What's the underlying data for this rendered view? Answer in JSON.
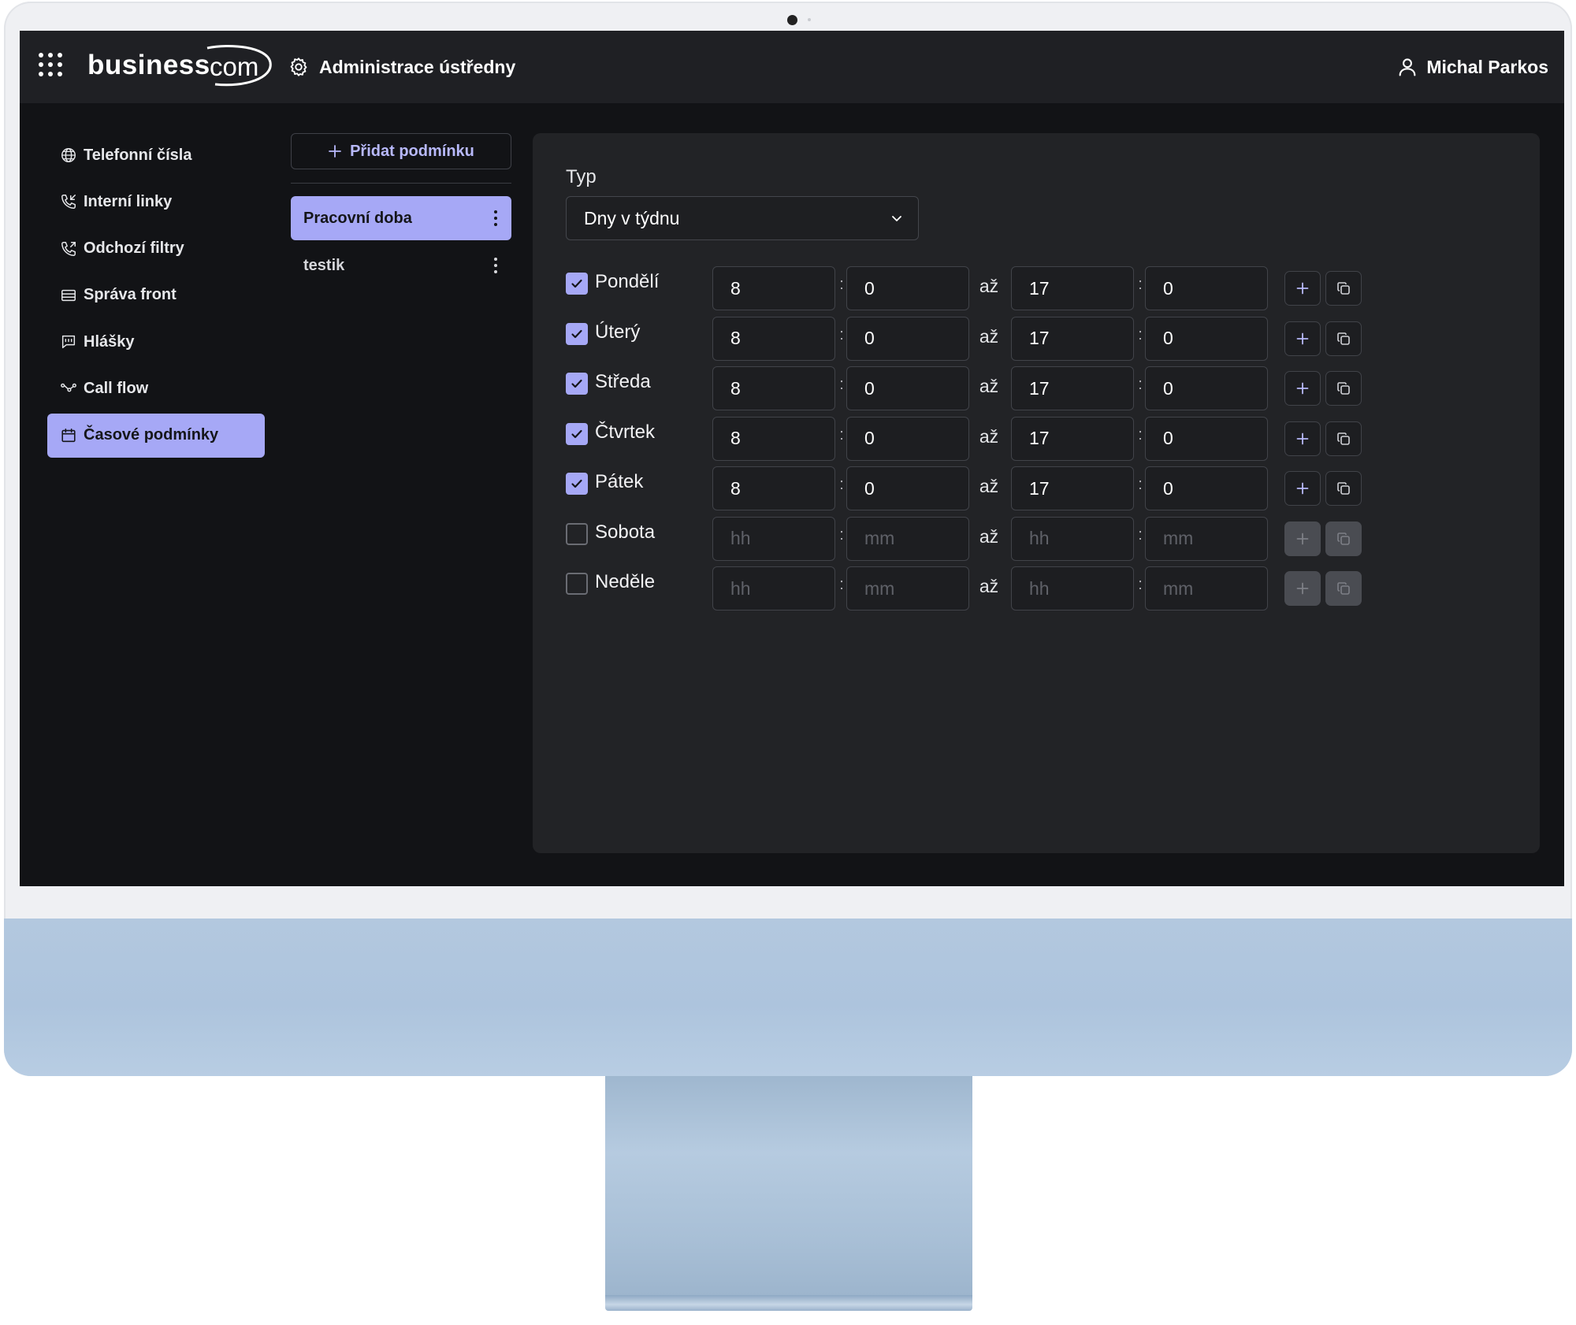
{
  "app": {
    "logo_main": "business",
    "logo_suffix": "com",
    "admin_title": "Administrace ústředny",
    "user_name": "Michal Parkos"
  },
  "sidebar": {
    "items": [
      {
        "label": "Telefonní čísla",
        "icon": "globe-icon",
        "active": false
      },
      {
        "label": "Interní linky",
        "icon": "phone-incoming-icon",
        "active": false
      },
      {
        "label": "Odchozí filtry",
        "icon": "phone-outgoing-icon",
        "active": false
      },
      {
        "label": "Správa front",
        "icon": "list-icon",
        "active": false
      },
      {
        "label": "Hlášky",
        "icon": "message-icon",
        "active": false
      },
      {
        "label": "Call flow",
        "icon": "flow-icon",
        "active": false
      },
      {
        "label": "Časové podmínky",
        "icon": "calendar-icon",
        "active": true
      }
    ]
  },
  "conditions": {
    "add_label": "Přidat podmínku",
    "items": [
      {
        "label": "Pracovní doba",
        "active": true
      },
      {
        "label": "testik",
        "active": false
      }
    ]
  },
  "form": {
    "type_label": "Typ",
    "type_value": "Dny v týdnu",
    "separator_label": "až",
    "placeholder_hours": "hh",
    "placeholder_minutes": "mm",
    "days": [
      {
        "label": "Pondělí",
        "checked": true,
        "from_h": "8",
        "from_m": "0",
        "to_h": "17",
        "to_m": "0"
      },
      {
        "label": "Úterý",
        "checked": true,
        "from_h": "8",
        "from_m": "0",
        "to_h": "17",
        "to_m": "0"
      },
      {
        "label": "Středa",
        "checked": true,
        "from_h": "8",
        "from_m": "0",
        "to_h": "17",
        "to_m": "0"
      },
      {
        "label": "Čtvrtek",
        "checked": true,
        "from_h": "8",
        "from_m": "0",
        "to_h": "17",
        "to_m": "0"
      },
      {
        "label": "Pátek",
        "checked": true,
        "from_h": "8",
        "from_m": "0",
        "to_h": "17",
        "to_m": "0"
      },
      {
        "label": "Sobota",
        "checked": false,
        "from_h": "",
        "from_m": "",
        "to_h": "",
        "to_m": ""
      },
      {
        "label": "Neděle",
        "checked": false,
        "from_h": "",
        "from_m": "",
        "to_h": "",
        "to_m": ""
      }
    ]
  },
  "colors": {
    "accent": "#a6a8f6",
    "screen_bg": "#121316",
    "topbar_bg": "#1f2024",
    "panel_bg": "#222326",
    "monitor_blue": "#b0c6de"
  }
}
